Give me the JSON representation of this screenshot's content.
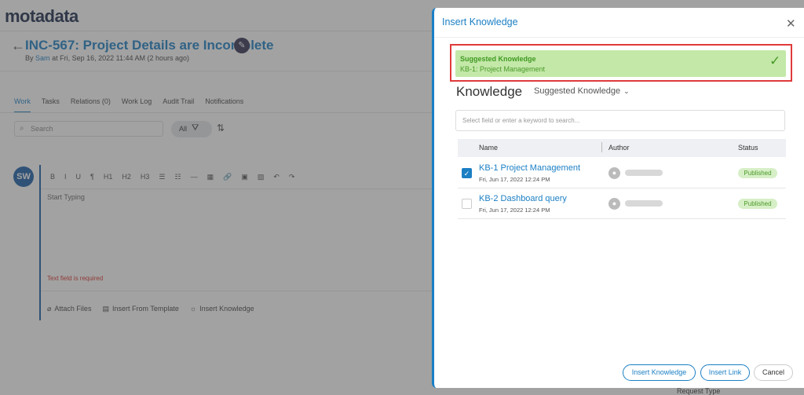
{
  "app": {
    "logo": "motadata",
    "ticket": {
      "title": "INC-567: Project Details are Incomplete",
      "meta_prefix": "By",
      "author": "Sam",
      "meta_suffix": "at Fri, Sep 16, 2022 11:44 AM (2 hours ago)"
    },
    "tabs": [
      "Work",
      "Tasks",
      "Relations (0)",
      "Work Log",
      "Audit Trail",
      "Notifications"
    ],
    "active_tab": "Work",
    "search_placeholder": "Search",
    "filter_label": "All",
    "avatar_initials": "SW",
    "editor": {
      "toolbar": [
        "B",
        "I",
        "U",
        "¶",
        "H1",
        "H2",
        "H3",
        "☰",
        "☷",
        "—",
        "▦",
        "🔗",
        "▣",
        "▨",
        "↶",
        "↷"
      ],
      "placeholder": "Start Typing",
      "error": "Text field is required",
      "actions": [
        {
          "icon": "paperclip-icon",
          "label": "Attach Files"
        },
        {
          "icon": "template-icon",
          "label": "Insert From Template"
        },
        {
          "icon": "bulb-icon",
          "label": "Insert Knowledge"
        }
      ]
    },
    "request_type_label": "Request Type"
  },
  "modal": {
    "title": "Insert Knowledge",
    "suggested": {
      "title": "Suggested Knowledge",
      "item": "KB-1: Project Management"
    },
    "heading": "Knowledge",
    "dropdown_value": "Suggested Knowledge",
    "search_placeholder": "Select field or enter a keyword to search...",
    "columns": {
      "name": "Name",
      "author": "Author",
      "status": "Status"
    },
    "rows": [
      {
        "name": "KB-1 Project Management",
        "date": "Fri, Jun 17, 2022 12:24 PM",
        "status": "Published",
        "checked": true
      },
      {
        "name": "KB-2 Dashboard query",
        "date": "Fri, Jun 17, 2022 12:24 PM",
        "status": "Published",
        "checked": false
      }
    ],
    "buttons": {
      "insert_knowledge": "Insert Knowledge",
      "insert_link": "Insert Link",
      "cancel": "Cancel"
    }
  },
  "colors": {
    "accent": "#1b7fc4",
    "success_bg": "#c3e8a8",
    "success_text": "#4a9a28",
    "highlight_border": "#e03a3a"
  }
}
